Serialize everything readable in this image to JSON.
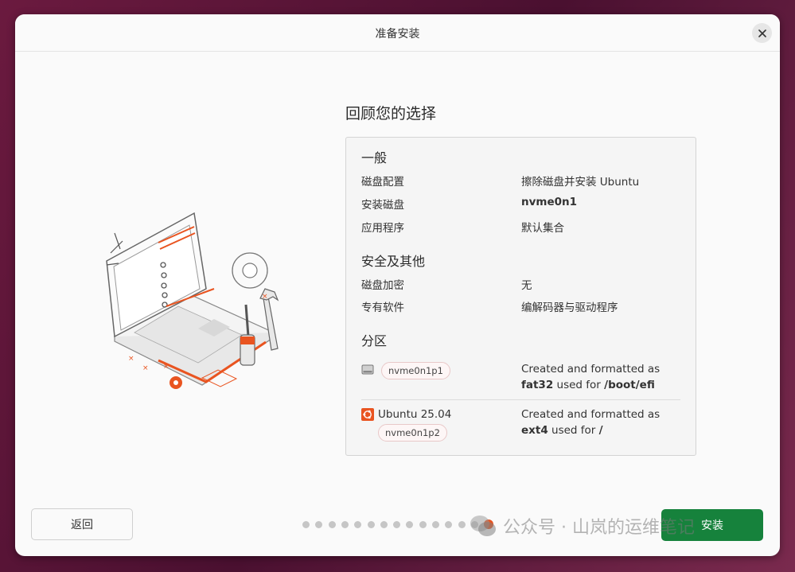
{
  "window": {
    "title": "准备安装"
  },
  "main": {
    "heading": "回顾您的选择"
  },
  "general": {
    "title": "一般",
    "rows": [
      {
        "label": "磁盘配置",
        "value": "擦除磁盘并安装 Ubuntu"
      },
      {
        "label": "安装磁盘",
        "value": "nvme0n1"
      },
      {
        "label": "应用程序",
        "value": "默认集合"
      }
    ]
  },
  "security": {
    "title": "安全及其他",
    "rows": [
      {
        "label": "磁盘加密",
        "value": "无"
      },
      {
        "label": "专有软件",
        "value": "编解码器与驱动程序"
      }
    ]
  },
  "partitions": {
    "title": "分区",
    "items": [
      {
        "name": "",
        "device": "nvme0n1p1",
        "desc_prefix": "Created and formatted as",
        "fs": "fat32",
        "used_for": "used for",
        "mount": "/boot/efi"
      },
      {
        "name": "Ubuntu 25.04",
        "device": "nvme0n1p2",
        "desc_prefix": "Created and formatted as",
        "fs": "ext4",
        "used_for": "used for",
        "mount": "/"
      }
    ]
  },
  "footer": {
    "back_label": "返回",
    "install_label": "安装",
    "page_total": 15,
    "page_current": 15
  },
  "watermark": {
    "text": "公众号 · 山岚的运维笔记"
  },
  "colors": {
    "accent": "#e95420",
    "install": "#16823c",
    "background": "#fafafa"
  },
  "icons": [
    "close-icon",
    "disk-icon",
    "ubuntu-icon",
    "wechat-icon"
  ]
}
